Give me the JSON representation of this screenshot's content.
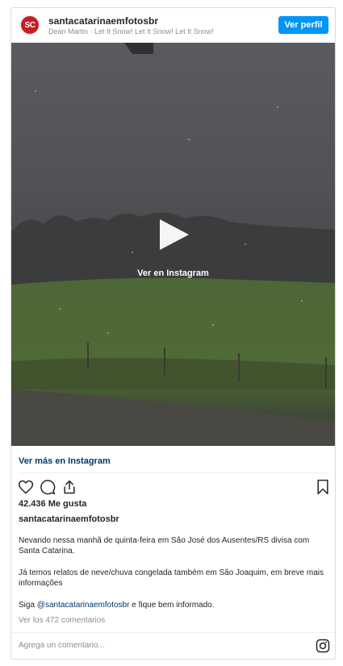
{
  "header": {
    "username": "santacatarinaemfotosbr",
    "song": "Dean Martin · Let It Snow! Let It Snow! Let It Snow!",
    "avatar_text": "SC",
    "profile_button": "Ver perfil"
  },
  "video": {
    "play_label": "Ver en Instagram"
  },
  "links": {
    "more": "Ver más en Instagram"
  },
  "actions": {
    "like_icon": "heart-icon",
    "comment_icon": "comment-icon",
    "share_icon": "share-icon",
    "save_icon": "bookmark-icon"
  },
  "post": {
    "likes": "42.436 Me gusta",
    "caption_user": "santacatarinaemfotosbr",
    "paragraph_1": "Nevando nessa manhã de quinta-feira em São José dos Ausentes/RS divisa com Santa Catarina.",
    "paragraph_2": "Já temos relatos de neve/chuva congelada também em São Joaquim, em breve mais informações",
    "paragraph_3_prefix": "Siga ",
    "paragraph_3_mention": "@santacatarinaemfotosbr",
    "paragraph_3_suffix": " e fique bem informado.",
    "comments_link": "Ver los 472 comentarios"
  },
  "comment_bar": {
    "placeholder": "Agrega un comentario...",
    "icon": "instagram-icon"
  },
  "colors": {
    "accent": "#0095f6",
    "link": "#00376b",
    "muted": "#8e8e8e",
    "avatar_red": "#c81d25"
  }
}
